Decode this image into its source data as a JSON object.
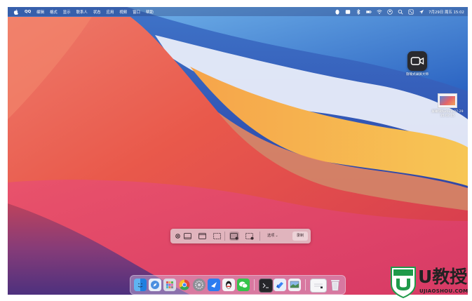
{
  "menubar": {
    "apple_icon": "apple-logo-icon",
    "items": [
      "QQ",
      "编辑",
      "格式",
      "显示",
      "联系人",
      "状态",
      "应用",
      "视频",
      "窗口",
      "帮助"
    ],
    "status_icons": [
      "qq-penguin-icon",
      "finder-tray-icon",
      "bluetooth-icon",
      "battery-icon",
      "wifi-icon",
      "user-switch-icon",
      "search-icon",
      "control-center-icon",
      "location-icon"
    ],
    "datetime": "7月29日 周五 15:02"
  },
  "desktop": {
    "screen_recorder_label": "隐喻式录屏大师",
    "screenshot_file_label": "屏幕快照2022-07-29 15.02.15"
  },
  "toolbar": {
    "options_label": "选项",
    "capture_label": "录制",
    "buttons": [
      "close-icon",
      "capture-window-icon",
      "capture-selection-icon",
      "record-screen-icon",
      "record-selection-icon"
    ]
  },
  "dock": {
    "apps": [
      "finder-icon",
      "safari-icon",
      "launchpad-icon",
      "chrome-icon",
      "system-preferences-icon",
      "lark-icon",
      "qq-icon",
      "wechat-icon",
      "terminal-icon",
      "feishu-icon",
      "preview-icon",
      "notes-icon",
      "trash-icon"
    ]
  },
  "watermark": {
    "brand": "U教授",
    "url": "UJIAOSHOU.COM"
  },
  "colors": {
    "watermark_green": "#1f9a4a",
    "capture_active": "#3b2a30"
  }
}
